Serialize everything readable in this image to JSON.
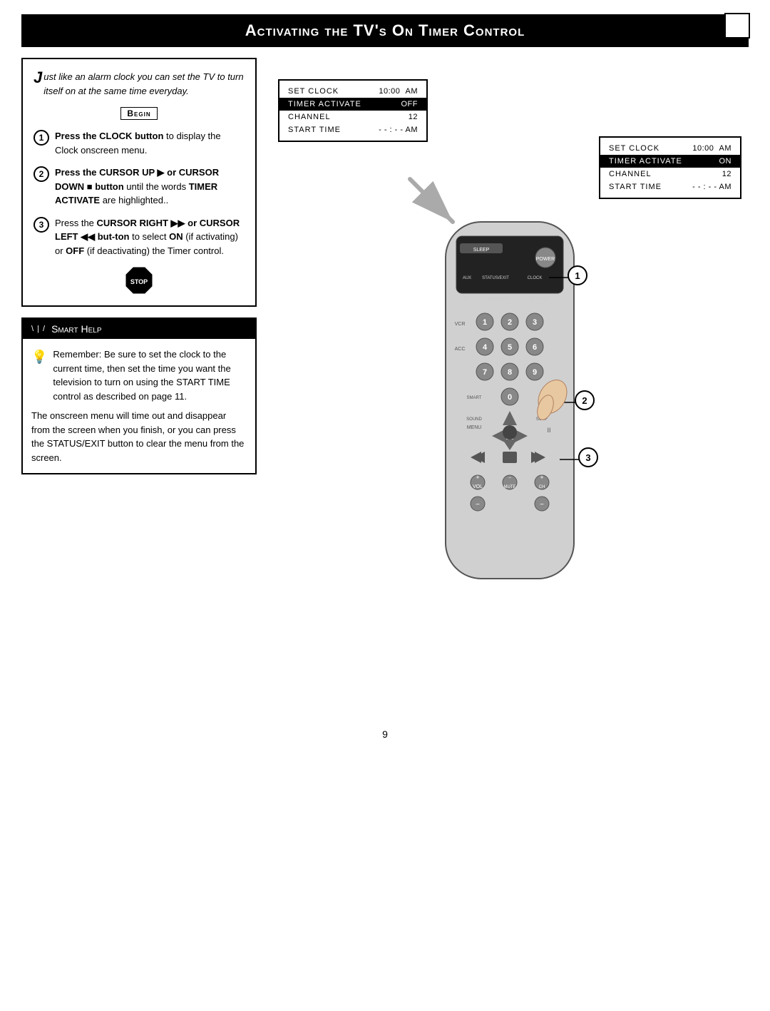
{
  "header": {
    "title": "Activating the TV's On Timer Control",
    "corner_box": true
  },
  "instructions": {
    "intro": "Just like an alarm clock you can set the TV to turn itself on at the same time everyday.",
    "intro_drop_cap": "J",
    "begin_label": "Begin",
    "steps": [
      {
        "number": "1",
        "text_parts": [
          {
            "bold": true,
            "text": "Press the CLOCK button"
          },
          {
            "bold": false,
            "text": " to display the Clock onscreen menu."
          }
        ]
      },
      {
        "number": "2",
        "text_parts": [
          {
            "bold": true,
            "text": "Press the CURSOR UP ▶ or CURSOR DOWN ■ button"
          },
          {
            "bold": false,
            "text": " until the words "
          },
          {
            "bold": true,
            "text": "TIMER ACTIVATE"
          },
          {
            "bold": false,
            "text": " are highlighted.."
          }
        ]
      },
      {
        "number": "3",
        "text_parts": [
          {
            "bold": false,
            "text": "Press the "
          },
          {
            "bold": true,
            "text": "CURSOR RIGHT ▶▶ or CURSOR LEFT ◀◀ but-ton"
          },
          {
            "bold": false,
            "text": " to select "
          },
          {
            "bold": true,
            "text": "ON"
          },
          {
            "bold": false,
            "text": " (if activating) or "
          },
          {
            "bold": true,
            "text": "OFF"
          },
          {
            "bold": false,
            "text": " (if deactivating) the Timer control."
          }
        ]
      }
    ]
  },
  "smart_help": {
    "title": "Smart Help",
    "paragraphs": [
      "Remember: Be sure to set the clock to the current time, then set the time you want the television to turn on using the START TIME control as described on page 11.",
      "The onscreen menu will time out and disappear from the screen when you finish, or you can press the STATUS/EXIT button to clear the menu from the screen."
    ]
  },
  "menu_before": {
    "rows": [
      {
        "label": "SET CLOCK",
        "value": "10:00  AM",
        "highlighted": false
      },
      {
        "label": "TIMER ACTIVATE",
        "value": "OFF",
        "highlighted": true
      },
      {
        "label": "CHANNEL",
        "value": "12",
        "highlighted": false
      },
      {
        "label": "START TIME",
        "value": "- - : - - AM",
        "highlighted": false
      }
    ]
  },
  "menu_after": {
    "rows": [
      {
        "label": "SET CLOCK",
        "value": "10:00  AM",
        "highlighted": false
      },
      {
        "label": "TIMER ACTIVATE",
        "value": "ON",
        "highlighted": true
      },
      {
        "label": "CHANNEL",
        "value": "12",
        "highlighted": false
      },
      {
        "label": "START TIME",
        "value": "- - : - - AM",
        "highlighted": false
      }
    ]
  },
  "callouts": [
    "1",
    "2",
    "3"
  ],
  "page_number": "9",
  "colors": {
    "black": "#000000",
    "white": "#ffffff",
    "highlight_bg": "#000000",
    "highlight_text": "#ffffff"
  }
}
